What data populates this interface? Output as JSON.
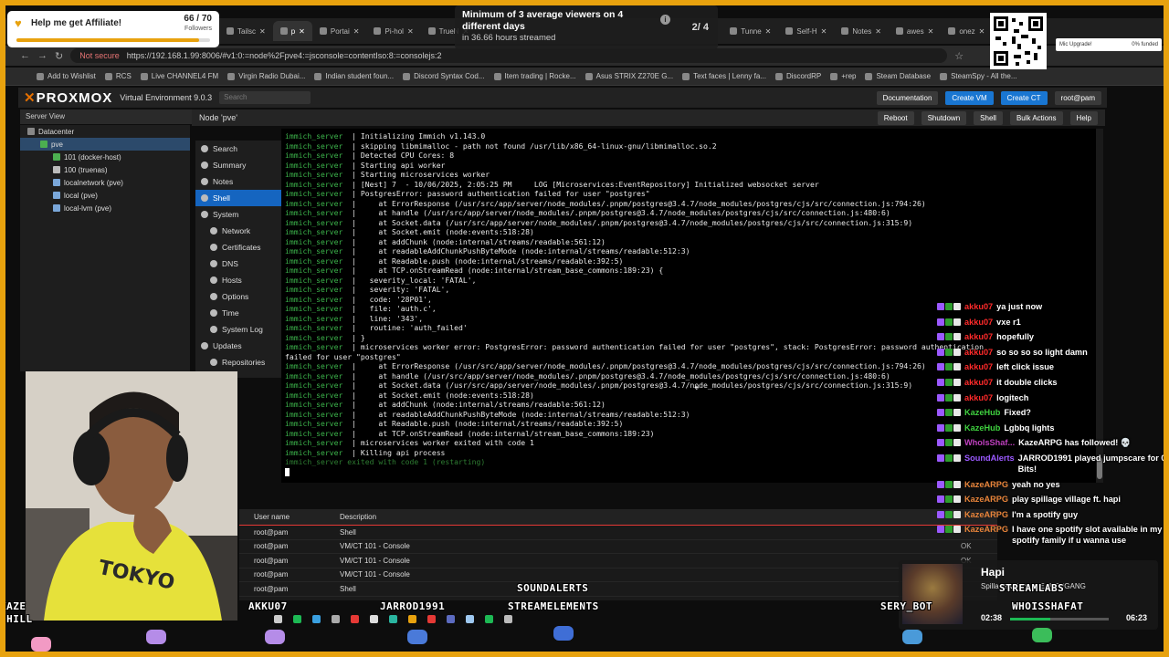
{
  "affiliate": {
    "title": "Help me get Affiliate!",
    "count": "66 / 70",
    "sub": "Followers",
    "progress": 0.943
  },
  "goal": {
    "text": "Minimum of 3 average viewers on 4 different days",
    "sub": "in 36.66 hours streamed",
    "count": "2/ 4"
  },
  "funding": {
    "label": "Mic Upgrade!",
    "value": "0% funded"
  },
  "browser": {
    "tabs": [
      {
        "label": "Tailsc",
        "active": false
      },
      {
        "label": "p",
        "active": true
      },
      {
        "label": "Portai",
        "active": false
      },
      {
        "label": "Pi-hol",
        "active": false
      },
      {
        "label": "TrueN",
        "active": false
      },
      {
        "label": "Tunne",
        "active": false
      },
      {
        "label": "Self-H",
        "active": false
      },
      {
        "label": "Notes",
        "active": false
      },
      {
        "label": "awes",
        "active": false
      },
      {
        "label": "onez",
        "active": false
      },
      {
        "label": "192.1",
        "active": false
      }
    ],
    "not_secure": "Not secure",
    "url": "https://192.168.1.99:8006/#v1:0:=node%2Fpve4:=jsconsole=contentIso:8:=consolejs:2",
    "bookmarks": [
      "Add to Wishlist",
      "RCS",
      "Live CHANNEL4 FM",
      "Virgin Radio Dubai...",
      "Indian student foun...",
      "Discord Syntax Cod...",
      "Item trading | Rocke...",
      "Asus STRIX Z270E G...",
      "Text faces | Lenny fa...",
      "DiscordRP",
      "+rep",
      "Steam Database",
      "SteamSpy - All the..."
    ]
  },
  "proxmox": {
    "logo": "PROXMOX",
    "version": "Virtual Environment 9.0.3",
    "search_placeholder": "Search",
    "header_buttons": [
      "Documentation",
      "Create VM",
      "Create CT",
      "root@pam"
    ],
    "view": "Server View",
    "tree": [
      {
        "label": "Datacenter",
        "indent": 0,
        "selected": false
      },
      {
        "label": "pve",
        "indent": 1,
        "selected": true
      },
      {
        "label": "101 (docker-host)",
        "indent": 2,
        "selected": false
      },
      {
        "label": "100 (truenas)",
        "indent": 2,
        "selected": false
      },
      {
        "label": "localnetwork (pve)",
        "indent": 2,
        "selected": false
      },
      {
        "label": "local (pve)",
        "indent": 2,
        "selected": false
      },
      {
        "label": "local-lvm (pve)",
        "indent": 2,
        "selected": false
      }
    ],
    "node_title": "Node 'pve'",
    "node_buttons": [
      "Reboot",
      "Shutdown",
      "Shell",
      "Bulk Actions",
      "Help"
    ],
    "menu": [
      {
        "label": "Search",
        "sub": false,
        "selected": false
      },
      {
        "label": "Summary",
        "sub": false,
        "selected": false
      },
      {
        "label": "Notes",
        "sub": false,
        "selected": false
      },
      {
        "label": "Shell",
        "sub": false,
        "selected": true
      },
      {
        "label": "System",
        "sub": false,
        "selected": false
      },
      {
        "label": "Network",
        "sub": true,
        "selected": false
      },
      {
        "label": "Certificates",
        "sub": true,
        "selected": false
      },
      {
        "label": "DNS",
        "sub": true,
        "selected": false
      },
      {
        "label": "Hosts",
        "sub": true,
        "selected": false
      },
      {
        "label": "Options",
        "sub": true,
        "selected": false
      },
      {
        "label": "Time",
        "sub": true,
        "selected": false
      },
      {
        "label": "System Log",
        "sub": true,
        "selected": false
      },
      {
        "label": "Updates",
        "sub": false,
        "selected": false
      },
      {
        "label": "Repositories",
        "sub": true,
        "selected": false
      }
    ],
    "task_headers": [
      "User name",
      "Description"
    ],
    "tasks": [
      {
        "user": "root@pam",
        "desc": "Shell",
        "status": ""
      },
      {
        "user": "root@pam",
        "desc": "VM/CT 101 - Console",
        "status": "OK"
      },
      {
        "user": "root@pam",
        "desc": "VM/CT 101 - Console",
        "status": "OK"
      },
      {
        "user": "root@pam",
        "desc": "VM/CT 101 - Console",
        "status": ""
      },
      {
        "user": "root@pam",
        "desc": "Shell",
        "status": ""
      }
    ]
  },
  "terminal": {
    "prefix": "immich_server",
    "lines": [
      "  | Initializing Immich v1.143.0",
      "  | skipping libmimalloc - path not found /usr/lib/x86_64-linux-gnu/libmimalloc.so.2",
      "  | Detected CPU Cores: 8",
      "  | Starting api worker",
      "  | Starting microservices worker",
      "  | [Nest] 7  - 10/06/2025, 2:05:25 PM     LOG [Microservices:EventRepository] Initialized websocket server",
      "  | PostgresError: password authentication failed for user \"postgres\"",
      "  |     at ErrorResponse (/usr/src/app/server/node_modules/.pnpm/postgres@3.4.7/node_modules/postgres/cjs/src/connection.js:794:26)",
      "  |     at handle (/usr/src/app/server/node_modules/.pnpm/postgres@3.4.7/node_modules/postgres/cjs/src/connection.js:480:6)",
      "  |     at Socket.data (/usr/src/app/server/node_modules/.pnpm/postgres@3.4.7/node_modules/postgres/cjs/src/connection.js:315:9)",
      "  |     at Socket.emit (node:events:518:28)",
      "  |     at addChunk (node:internal/streams/readable:561:12)",
      "  |     at readableAddChunkPushByteMode (node:internal/streams/readable:512:3)",
      "  |     at Readable.push (node:internal/streams/readable:392:5)",
      "  |     at TCP.onStreamRead (node:internal/stream_base_commons:189:23) {",
      "  |   severity_local: 'FATAL',",
      "  |   severity: 'FATAL',",
      "  |   code: '28P01',",
      "  |   file: 'auth.c',",
      "  |   line: '343',",
      "  |   routine: 'auth_failed'",
      "  | }",
      "  | microservices worker error: PostgresError: password authentication failed for user \"postgres\", stack: PostgresError: password authentication",
      "failed for user \"postgres\"",
      "  |     at ErrorResponse (/usr/src/app/server/node_modules/.pnpm/postgres@3.4.7/node_modules/postgres/cjs/src/connection.js:794:26)",
      "  |     at handle (/usr/src/app/server/node_modules/.pnpm/postgres@3.4.7/node_modules/postgres/cjs/src/connection.js:480:6)",
      "  |     at Socket.data (/usr/src/app/server/node_modules/.pnpm/postgres@3.4.7/node_modules/postgres/cjs/src/connection.js:315:9)",
      "  |     at Socket.emit (node:events:518:28)",
      "  |     at addChunk (node:internal/streams/readable:561:12)",
      "  |     at readableAddChunkPushByteMode (node:internal/streams/readable:512:3)",
      "  |     at Readable.push (node:internal/streams/readable:392:5)",
      "  |     at TCP.onStreamRead (node:internal/stream_base_commons:189:23)",
      "  | microservices worker exited with code 1",
      "  | Killing api process",
      " exited with code 1 (restarting)"
    ],
    "no_prefix_lines": [
      23
    ],
    "dim_lines": [
      34
    ]
  },
  "chat": [
    {
      "name": "akku07",
      "text": "ya just now",
      "color": "#ff2a2a"
    },
    {
      "name": "akku07",
      "text": "vxe r1",
      "color": "#ff2a2a"
    },
    {
      "name": "akku07",
      "text": "hopefully",
      "color": "#ff2a2a"
    },
    {
      "name": "akku07",
      "text": "so so so so light damn",
      "color": "#ff2a2a"
    },
    {
      "name": "akku07",
      "text": "left click issue",
      "color": "#ff2a2a"
    },
    {
      "name": "akku07",
      "text": "it double clicks",
      "color": "#ff2a2a"
    },
    {
      "name": "akku07",
      "text": "logitech",
      "color": "#ff2a2a"
    },
    {
      "name": "KazeHub",
      "text": "Fixed?",
      "color": "#3fd13f"
    },
    {
      "name": "KazeHub",
      "text": "Lgbbq lights",
      "color": "#3fd13f"
    },
    {
      "name": "WhoIsShaf...",
      "text": "KazeARPG has followed! 💀",
      "color": "#c040c0"
    },
    {
      "name": "SoundAlerts",
      "text": "JARROD1991 played jumpscare for 0 Bits!",
      "color": "#9b59ff"
    },
    {
      "name": "KazeARPG",
      "text": "yeah no yes",
      "color": "#e8843a"
    },
    {
      "name": "KazeARPG",
      "text": "play spillage village ft. hapi",
      "color": "#e8843a"
    },
    {
      "name": "KazeARPG",
      "text": "I'm a spotify guy",
      "color": "#e8843a"
    },
    {
      "name": "KazeARPG",
      "text": "I have one spotify slot available in my spotify family if u wanna use",
      "color": "#e8843a"
    }
  ],
  "music": {
    "song": "Hapi",
    "artist": "Spillage Village & EARTHGANG",
    "elapsed": "02:38",
    "duration": "06:23",
    "progress": 0.41
  },
  "bottom_names": [
    "KAZE",
    "CHILL",
    "AKKU07",
    "JARROD1991",
    "SOUNDALERTS",
    "STREAMELEMENTS",
    "SERY_BOT",
    "STREAMLABS",
    "WHOISSHAFAT"
  ],
  "webcam_shirt_text": "TOKYO"
}
